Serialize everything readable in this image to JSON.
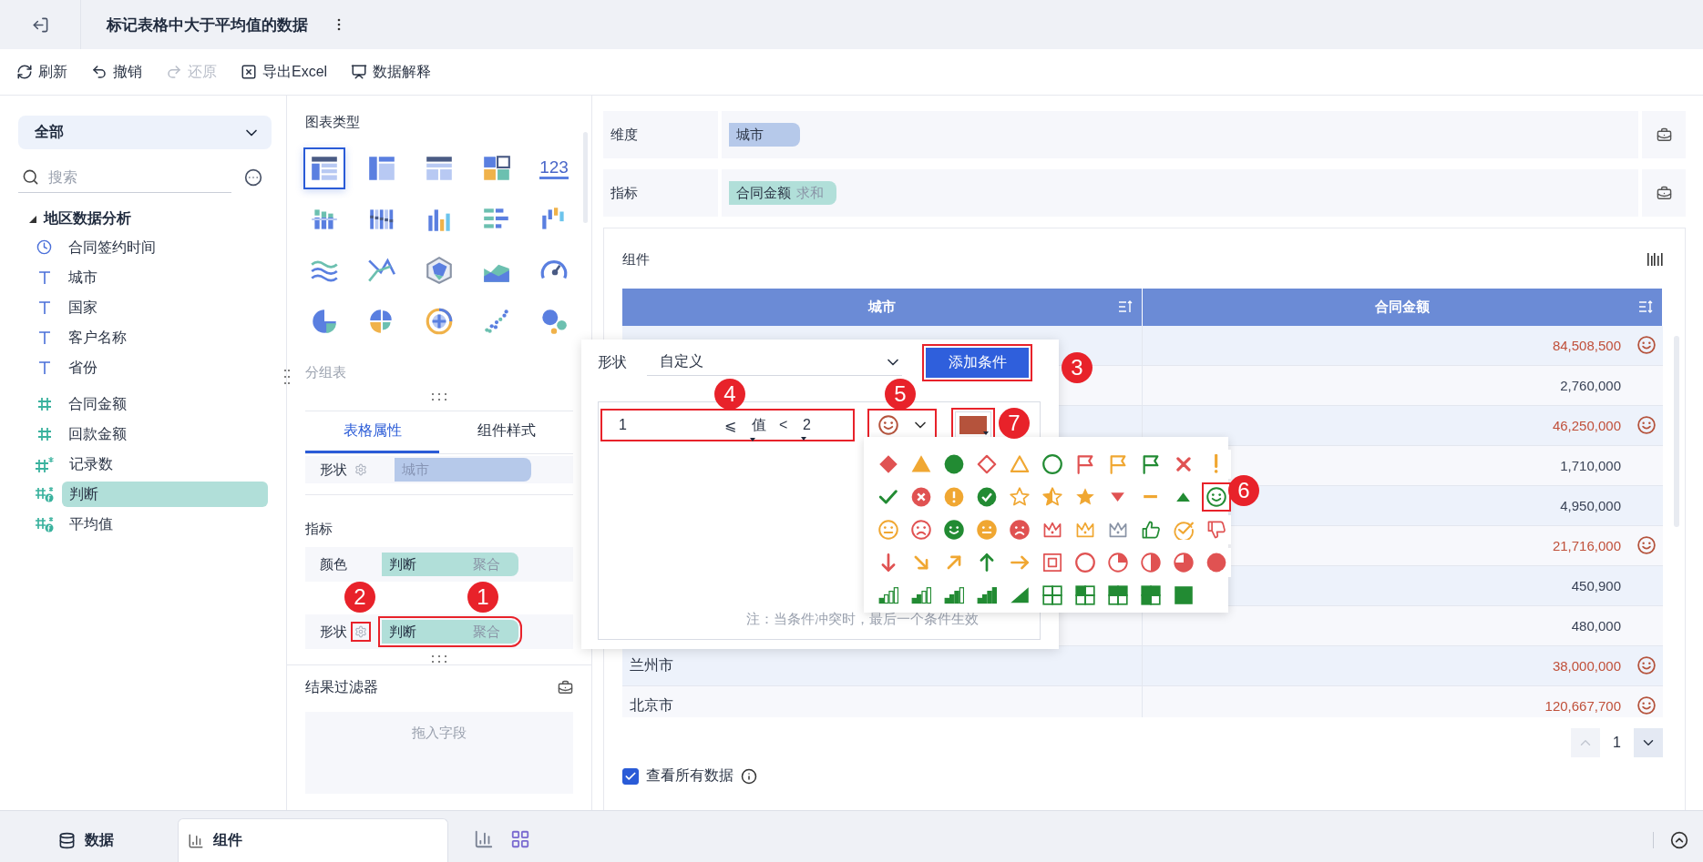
{
  "header": {
    "title": "标记表格中大于平均值的数据"
  },
  "toolbar": [
    {
      "label": "刷新",
      "disabled": false
    },
    {
      "label": "撤销",
      "disabled": false
    },
    {
      "label": "还原",
      "disabled": true
    },
    {
      "label": "导出Excel",
      "disabled": false
    },
    {
      "label": "数据解释",
      "disabled": false
    }
  ],
  "sidebar": {
    "scope": "全部",
    "search": {
      "placeholder": "搜索"
    },
    "tree": [
      {
        "label": "地区数据分析",
        "expanded": true,
        "children": [
          {
            "label": "合同签约时间",
            "kind": "time",
            "selected": false
          },
          {
            "label": "城市",
            "kind": "text",
            "selected": false
          },
          {
            "label": "国家",
            "kind": "text",
            "selected": false
          },
          {
            "label": "客户名称",
            "kind": "text",
            "selected": false
          },
          {
            "label": "省份",
            "kind": "text",
            "selected": false
          },
          {
            "label": "合同金额",
            "kind": "number",
            "selected": false
          },
          {
            "label": "回款金额",
            "kind": "number",
            "selected": false
          },
          {
            "label": "记录数",
            "kind": "count",
            "selected": false
          },
          {
            "label": "判断",
            "kind": "calc",
            "selected": true
          },
          {
            "label": "平均值",
            "kind": "calc",
            "selected": false
          }
        ]
      }
    ]
  },
  "chart_types": {
    "title": "图表类型",
    "group_label": "分组表",
    "items": [
      {
        "kind": "table",
        "selected": true
      },
      {
        "kind": "cross-table",
        "selected": false
      },
      {
        "kind": "detail-table",
        "selected": false
      },
      {
        "kind": "card",
        "selected": false
      },
      {
        "kind": "number",
        "label": "123",
        "selected": false
      },
      {
        "kind": "stacked-bar",
        "selected": false
      },
      {
        "kind": "multi-bar",
        "selected": false
      },
      {
        "kind": "bar",
        "selected": false
      },
      {
        "kind": "hbar",
        "selected": false
      },
      {
        "kind": "waterfall",
        "selected": false
      },
      {
        "kind": "wave",
        "selected": false
      },
      {
        "kind": "cross-line",
        "selected": false
      },
      {
        "kind": "radar",
        "selected": false
      },
      {
        "kind": "area",
        "selected": false
      },
      {
        "kind": "gauge",
        "selected": false
      },
      {
        "kind": "pie",
        "selected": false
      },
      {
        "kind": "rose",
        "selected": false
      },
      {
        "kind": "sunburst",
        "selected": false
      },
      {
        "kind": "scatter",
        "selected": false
      },
      {
        "kind": "bubble",
        "selected": false
      }
    ]
  },
  "property_tabs": [
    {
      "label": "表格属性",
      "selected": true
    },
    {
      "label": "组件样式",
      "selected": false
    }
  ],
  "properties": {
    "top_row": {
      "label": "形状",
      "chip": "城市",
      "settings": true
    },
    "measure_title": "指标",
    "measure_rows": [
      {
        "label": "颜色",
        "field": "判断",
        "aggregation": "聚合",
        "settings": false
      },
      {
        "label": "形状",
        "field": "判断",
        "aggregation": "聚合",
        "settings": true
      }
    ]
  },
  "result_filter": {
    "title": "结果过滤器",
    "placeholder": "拖入字段"
  },
  "dimensions": {
    "label": "维度",
    "chips": [
      "城市"
    ]
  },
  "measures": {
    "label": "指标",
    "chips": [
      {
        "name": "合同金额",
        "aggregation": "求和"
      }
    ]
  },
  "component": {
    "title": "组件",
    "columns": [
      "城市",
      "合同金额"
    ],
    "rows": [
      {
        "value": "84,508,500",
        "marked": true
      },
      {
        "value": "2,760,000",
        "marked": false
      },
      {
        "value": "46,250,000",
        "marked": true
      },
      {
        "value": "1,710,000",
        "marked": false
      },
      {
        "value": "4,950,000",
        "marked": false
      },
      {
        "value": "21,716,000",
        "marked": true
      },
      {
        "value": "450,900",
        "marked": false
      },
      {
        "value": "480,000",
        "marked": false
      },
      {
        "city": "兰州市",
        "value": "38,000,000",
        "marked": true
      },
      {
        "city": "北京市",
        "value": "120,667,700",
        "marked": true
      }
    ],
    "page": "1",
    "show_all": {
      "label": "查看所有数据",
      "checked": true
    }
  },
  "shape_popup": {
    "label": "形状",
    "mode": "自定义",
    "add_button": "添加条件",
    "condition": {
      "low": "1",
      "op_low": "⩽",
      "subject": "值",
      "op_high": "<",
      "high": "2",
      "color": "#b5533c"
    },
    "note": "注：当条件冲突时，最后一个条件生效"
  },
  "shape_palette": [
    {
      "kind": "diamond",
      "color": "#e05252",
      "selected": false
    },
    {
      "kind": "triangle",
      "color": "#f0a732",
      "selected": false
    },
    {
      "kind": "circle",
      "color": "#228b33",
      "selected": false
    },
    {
      "kind": "diamond-outline",
      "color": "#e05252",
      "selected": false
    },
    {
      "kind": "triangle-outline",
      "color": "#f0a732",
      "selected": false
    },
    {
      "kind": "circle-outline",
      "color": "#228b33",
      "selected": false
    },
    {
      "kind": "flag",
      "color": "#e05252",
      "selected": false
    },
    {
      "kind": "flag",
      "color": "#f0a732",
      "selected": false
    },
    {
      "kind": "flag",
      "color": "#228b33",
      "selected": false
    },
    {
      "kind": "cross",
      "color": "#e05252",
      "selected": false
    },
    {
      "kind": "exclaim",
      "color": "#f0a732",
      "selected": false
    },
    {
      "kind": "check",
      "color": "#228b33",
      "selected": false
    },
    {
      "kind": "cross-circle",
      "color": "#e05252",
      "selected": false
    },
    {
      "kind": "exclaim-circle",
      "color": "#f0a732",
      "selected": false
    },
    {
      "kind": "check-circle",
      "color": "#228b33",
      "selected": false
    },
    {
      "kind": "star-outline",
      "color": "#f0a732",
      "selected": false
    },
    {
      "kind": "star-half",
      "color": "#f0a732",
      "selected": false
    },
    {
      "kind": "star",
      "color": "#f0a732",
      "selected": false
    },
    {
      "kind": "triangle-down",
      "color": "#e05252",
      "selected": false
    },
    {
      "kind": "dash",
      "color": "#f0a732",
      "selected": false
    },
    {
      "kind": "triangle-up",
      "color": "#228b33",
      "selected": false
    },
    {
      "kind": "smile",
      "color": "#228b33",
      "selected": true
    },
    {
      "kind": "neutral",
      "color": "#f0a732",
      "selected": false
    },
    {
      "kind": "sad",
      "color": "#e05252",
      "selected": false
    },
    {
      "kind": "smile-filled",
      "color": "#228b33",
      "selected": false
    },
    {
      "kind": "neutral-filled",
      "color": "#f0a732",
      "selected": false
    },
    {
      "kind": "sad-filled",
      "color": "#e05252",
      "selected": false
    },
    {
      "kind": "crown",
      "color": "#e05252",
      "selected": false
    },
    {
      "kind": "crown",
      "color": "#f0a732",
      "selected": false
    },
    {
      "kind": "crown",
      "color": "#8a94a6",
      "selected": false
    },
    {
      "kind": "thumbs-up",
      "color": "#228b33",
      "selected": false
    },
    {
      "kind": "check-ring",
      "color": "#f0a732",
      "selected": false
    },
    {
      "kind": "thumbs-down",
      "color": "#e05252",
      "selected": false
    },
    {
      "kind": "arrow-down",
      "color": "#e05252",
      "selected": false
    },
    {
      "kind": "arrow-down-right",
      "color": "#f0a732",
      "selected": false
    },
    {
      "kind": "arrow-up-right",
      "color": "#f0a732",
      "selected": false
    },
    {
      "kind": "arrow-up",
      "color": "#228b33",
      "selected": false
    },
    {
      "kind": "arrow-right",
      "color": "#f0a732",
      "selected": false
    },
    {
      "kind": "square-target",
      "color": "#e05252",
      "selected": false
    },
    {
      "kind": "circle-outline",
      "color": "#e05252",
      "selected": false
    },
    {
      "kind": "pie-quarter",
      "color": "#e05252",
      "selected": false
    },
    {
      "kind": "pie-half",
      "color": "#e05252",
      "selected": false
    },
    {
      "kind": "pie-3q",
      "color": "#e05252",
      "selected": false
    },
    {
      "kind": "circle",
      "color": "#e05252",
      "selected": false
    },
    {
      "kind": "signal-1",
      "color": "#228b33",
      "selected": false
    },
    {
      "kind": "signal-2",
      "color": "#228b33",
      "selected": false
    },
    {
      "kind": "signal-3",
      "color": "#228b33",
      "selected": false
    },
    {
      "kind": "signal-4",
      "color": "#228b33",
      "selected": false
    },
    {
      "kind": "signal-5",
      "color": "#228b33",
      "selected": false
    },
    {
      "kind": "grid-0",
      "color": "#228b33",
      "selected": false
    },
    {
      "kind": "grid-1",
      "color": "#228b33",
      "selected": false
    },
    {
      "kind": "grid-2",
      "color": "#228b33",
      "selected": false
    },
    {
      "kind": "grid-3",
      "color": "#228b33",
      "selected": false
    },
    {
      "kind": "grid-4",
      "color": "#228b33",
      "selected": false
    }
  ],
  "bottom_tabs": [
    {
      "label": "数据",
      "selected": false
    },
    {
      "label": "组件",
      "selected": true
    }
  ],
  "annotations": [
    "1",
    "2",
    "3",
    "4",
    "5",
    "6",
    "7"
  ]
}
